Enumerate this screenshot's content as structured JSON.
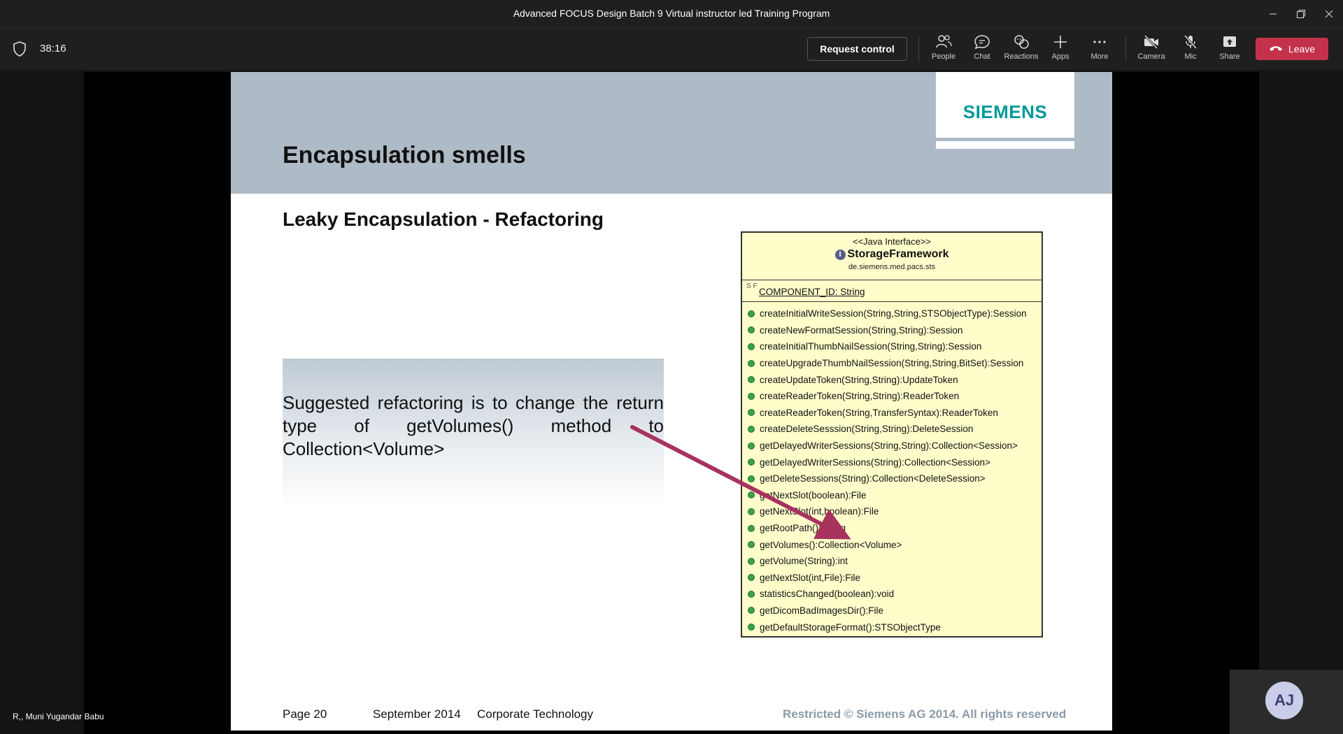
{
  "window": {
    "title": "Advanced FOCUS Design Batch 9 Virtual instructor led Training Program"
  },
  "meeting": {
    "timer": "38:16",
    "request_control_label": "Request control",
    "buttons": {
      "people": "People",
      "chat": "Chat",
      "reactions": "Reactions",
      "apps": "Apps",
      "more": "More",
      "camera": "Camera",
      "mic": "Mic",
      "share": "Share"
    },
    "leave_label": "Leave",
    "presenter_name": "R,, Muni Yugandar Babu",
    "participant_initials": "AJ"
  },
  "slide": {
    "logo": "SIEMENS",
    "title": "Encapsulation smells",
    "subtitle": "Leaky Encapsulation - Refactoring",
    "note": "Suggested refactoring is to change the return type of getVolumes() method to Collection<Volume>",
    "uml": {
      "stereotype": "<<Java Interface>>",
      "name": "StorageFramework",
      "package": "de.siemens.med.pacs.sts",
      "attribute_marker": "S F",
      "attribute": "COMPONENT_ID: String",
      "methods": [
        "createInitialWriteSession(String,String,STSObjectType):Session",
        "createNewFormatSession(String,String):Session",
        "createInitialThumbNailSession(String,String):Session",
        "createUpgradeThumbNailSession(String,String,BitSet):Session",
        "createUpdateToken(String,String):UpdateToken",
        "createReaderToken(String,String):ReaderToken",
        "createReaderToken(String,TransferSyntax):ReaderToken",
        "createDeleteSesssion(String,String):DeleteSession",
        "getDelayedWriterSessions(String,String):Collection<Session>",
        "getDelayedWriterSessions(String):Collection<Session>",
        "getDeleteSessions(String):Collection<DeleteSession>",
        "getNextSlot(boolean):File",
        "getNextSlot(int,boolean):File",
        "getRootPath():String",
        "getVolumes():Collection<Volume>",
        "getVolume(String):int",
        "getNextSlot(int,File):File",
        "statisticsChanged(boolean):void",
        "getDicomBadImagesDir():File",
        "getDefaultStorageFormat():STSObjectType"
      ]
    },
    "footer": {
      "page": "Page 20",
      "date": "September 2014",
      "department": "Corporate Technology",
      "copyright": "Restricted © Siemens AG 2014. All rights reserved"
    },
    "colors": {
      "header_band": "#aebbc6",
      "logo": "#009999",
      "uml_fill": "#fffecb",
      "arrow": "#a8325e"
    }
  },
  "icons": [
    "shield-icon",
    "people-icon",
    "chat-icon",
    "reactions-icon",
    "apps-icon",
    "more-icon",
    "camera-off-icon",
    "mic-off-icon",
    "share-icon",
    "phone-hangup-icon"
  ]
}
